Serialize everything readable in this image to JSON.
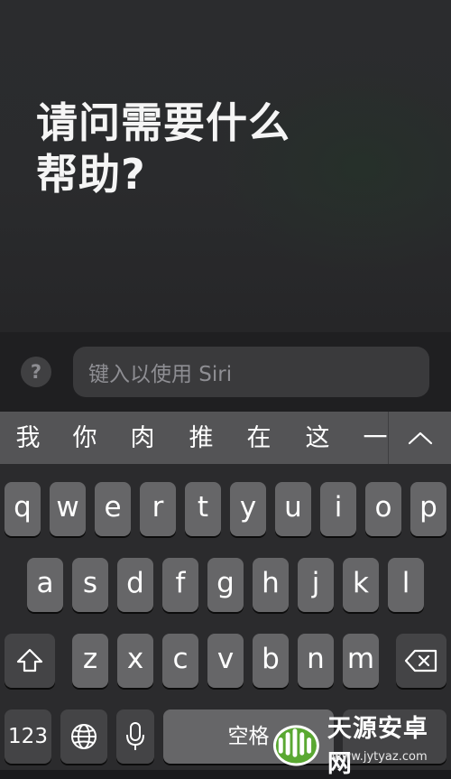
{
  "siri": {
    "prompt_line1": "请问需要什么",
    "prompt_line2": "帮助?"
  },
  "input": {
    "help_label": "?",
    "placeholder": "键入以使用 Siri"
  },
  "candidates": [
    "我",
    "你",
    "肉",
    "推",
    "在",
    "这",
    "一"
  ],
  "keyboard": {
    "row1": [
      "q",
      "w",
      "e",
      "r",
      "t",
      "y",
      "u",
      "i",
      "o",
      "p"
    ],
    "row2": [
      "a",
      "s",
      "d",
      "f",
      "g",
      "h",
      "j",
      "k",
      "l"
    ],
    "row3": [
      "z",
      "x",
      "c",
      "v",
      "b",
      "n",
      "m"
    ],
    "numbers_label": "123",
    "space_label": "空格",
    "icons": [
      "shift-icon",
      "delete-icon",
      "globe-icon",
      "microphone-icon",
      "chevron-up-icon"
    ]
  },
  "watermark": {
    "text": "天源安卓网",
    "url": "www.jytyaz.com"
  }
}
